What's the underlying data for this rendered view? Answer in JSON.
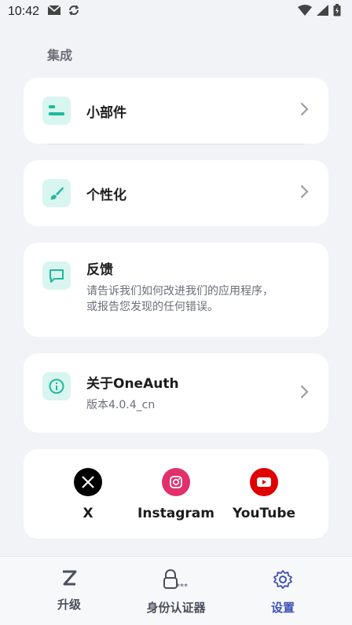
{
  "status_bar": {
    "time": "10:42",
    "icons": [
      "mail-icon",
      "sync-icon",
      "wifi-icon",
      "signal-icon",
      "battery-icon"
    ]
  },
  "section": {
    "title": "集成"
  },
  "items": {
    "widgets": {
      "label": "小部件",
      "icon": "widget-icon"
    },
    "personalize": {
      "label": "个性化",
      "icon": "brush-icon"
    },
    "feedback": {
      "label": "反馈",
      "description_line1": "请告诉我们如何改进我们的应用程序，",
      "description_line2": "或报告您发现的任何错误。",
      "icon": "chat-icon"
    },
    "about": {
      "label": "关于OneAuth",
      "version": "版本4.0.4_cn",
      "icon": "info-icon"
    }
  },
  "social": {
    "x": {
      "label": "X",
      "icon": "x-logo-icon"
    },
    "instagram": {
      "label": "Instagram",
      "icon": "instagram-logo-icon"
    },
    "youtube": {
      "label": "YouTube",
      "icon": "youtube-logo-icon"
    }
  },
  "tabs": {
    "upgrade": {
      "label": "升级",
      "icon": "z-logo-icon"
    },
    "authenticator": {
      "label": "身份认证器",
      "icon": "lock-password-icon"
    },
    "settings": {
      "label": "设置",
      "icon": "gear-icon"
    }
  },
  "colors": {
    "accent_teal": "#1fb99a",
    "accent_indigo": "#3f51b5",
    "instagram": "#e1306c",
    "youtube": "#e00000"
  }
}
